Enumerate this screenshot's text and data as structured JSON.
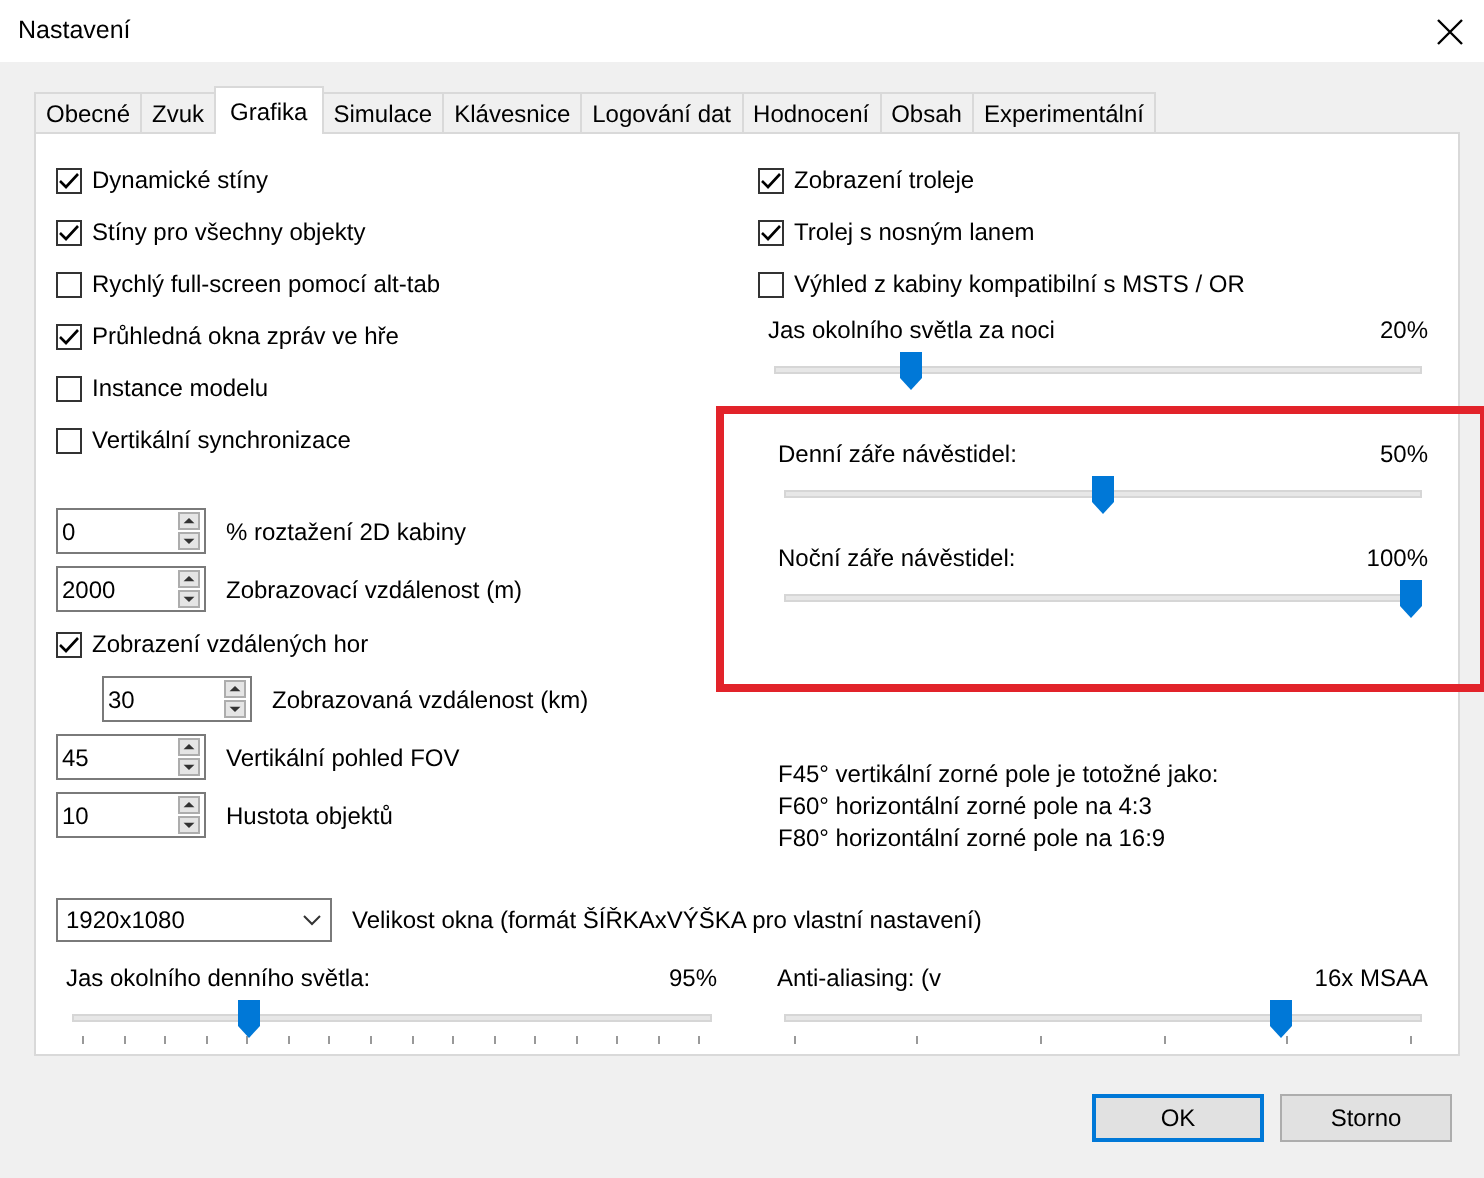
{
  "window": {
    "title": "Nastavení"
  },
  "tabs": [
    {
      "label": "Obecné",
      "selected": false
    },
    {
      "label": "Zvuk",
      "selected": false
    },
    {
      "label": "Grafika",
      "selected": true
    },
    {
      "label": "Simulace",
      "selected": false
    },
    {
      "label": "Klávesnice",
      "selected": false
    },
    {
      "label": "Logování dat",
      "selected": false
    },
    {
      "label": "Hodnocení",
      "selected": false
    },
    {
      "label": "Obsah",
      "selected": false
    },
    {
      "label": "Experimentální",
      "selected": false
    }
  ],
  "left_column": [
    {
      "kind": "checkbox",
      "label": "Dynamické stíny",
      "checked": true
    },
    {
      "kind": "checkbox",
      "label": "Stíny pro všechny objekty",
      "checked": true
    },
    {
      "kind": "checkbox",
      "label": "Rychlý full-screen pomocí alt-tab",
      "checked": false
    },
    {
      "kind": "checkbox",
      "label": "Průhledná okna zpráv ve hře",
      "checked": true
    },
    {
      "kind": "checkbox",
      "label": "Instance modelu",
      "checked": false
    },
    {
      "kind": "checkbox",
      "label": "Vertikální synchronizace",
      "checked": false
    },
    {
      "kind": "spinner",
      "value": "0",
      "caption": "% roztažení 2D kabiny",
      "indented": false
    },
    {
      "kind": "spinner",
      "value": "2000",
      "caption": "Zobrazovací vzdálenost (m)",
      "indented": false
    },
    {
      "kind": "checkbox",
      "label": "Zobrazení vzdálených hor",
      "checked": true
    },
    {
      "kind": "spinner",
      "value": "30",
      "caption": "Zobrazovaná vzdálenost (km)",
      "indented": true
    },
    {
      "kind": "spinner",
      "value": "45",
      "caption": "Vertikální pohled FOV",
      "indented": false
    },
    {
      "kind": "spinner",
      "value": "10",
      "caption": "Hustota objektů",
      "indented": false
    }
  ],
  "right_column": [
    {
      "kind": "checkbox",
      "label": "Zobrazení troleje",
      "checked": true
    },
    {
      "kind": "checkbox",
      "label": "Trolej s nosným lanem",
      "checked": true
    },
    {
      "kind": "checkbox",
      "label": "Výhled z kabiny kompatibilní s MSTS / OR",
      "checked": false
    },
    {
      "kind": "slider",
      "label": "Jas okolního světla za noci",
      "reading": "20%",
      "level": 0.2
    },
    {
      "kind": "group",
      "highlighted": true,
      "items": [
        {
          "kind": "slider",
          "label": "Denní záře návěstidel:",
          "reading": "50%",
          "level": 0.5
        },
        {
          "kind": "slider",
          "label": "Noční záře návěstidel:",
          "reading": "100%",
          "level": 1.0
        }
      ]
    },
    {
      "kind": "note",
      "lines": [
        "F45° vertikální zorné pole je totožné jako:",
        "F60° horizontální zorné pole na 4:3",
        "F80° horizontální zorné pole na 16:9"
      ]
    }
  ],
  "window_size": {
    "value": "1920x1080",
    "label": "Velikost okna (formát ŠÍŘKAxVÝŠKA pro vlastní nastavení)"
  },
  "bottom_sliders": [
    {
      "label": "Jas okolního denního světla:",
      "reading": "95%",
      "level": 0.27,
      "kind": "fine"
    },
    {
      "label": "Anti-aliasing: (v",
      "reading": "16x MSAA",
      "level": 0.79,
      "kind": "coarse"
    }
  ],
  "buttons": [
    {
      "label": "OK",
      "default": true
    },
    {
      "label": "Storno",
      "default": false
    }
  ]
}
